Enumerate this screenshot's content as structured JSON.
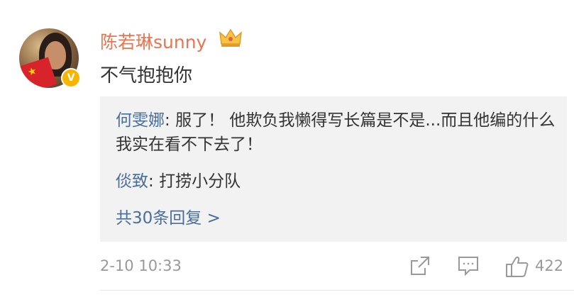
{
  "comment": {
    "username": "陈若琳sunny",
    "verified_badge": "V",
    "text": "不气抱抱你",
    "time": "2-10 10:33",
    "like_count": "422"
  },
  "replies": [
    {
      "author": "何雯娜",
      "text": "服了！ 他欺负我懒得写长篇是不是...而且他编的什么 我实在看不下去了！"
    },
    {
      "author": "倓致",
      "text": "打捞小分队"
    }
  ],
  "more_replies_label": "共30条回复 >",
  "icons": {
    "crown": "crown-icon",
    "share": "share-icon",
    "comment": "comment-icon",
    "like": "like-icon"
  },
  "colors": {
    "username": "#eb7350",
    "link": "#4a6e9b",
    "muted": "#999999",
    "reply_bg": "#f2f2f2",
    "badge": "#f7b500"
  }
}
